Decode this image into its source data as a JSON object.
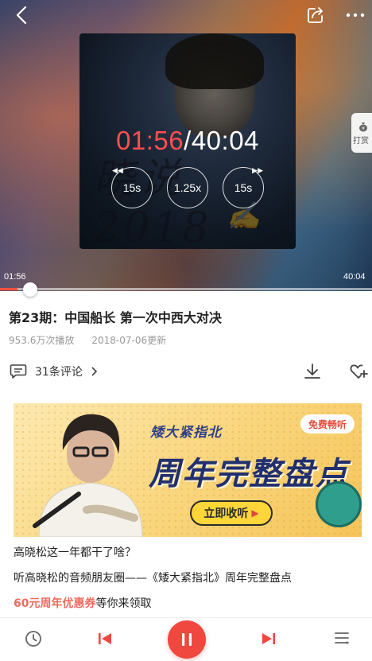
{
  "player": {
    "current_time": "01:56",
    "separator": "/",
    "total_time": "40:04",
    "skip_back_label": "15s",
    "speed_label": "1.25x",
    "skip_forward_label": "15s",
    "progress_start_time": "01:56",
    "progress_end_time": "40:04",
    "progress_fraction": 0.048,
    "tip_label": "打赏",
    "cover_signature_text": "晓说 2018",
    "accent_color": "#f0473e"
  },
  "episode": {
    "title": "第23期：中国船长 第一次中西大对决",
    "plays": "953.6万次播放",
    "updated": "2018-07-06更新",
    "comments_label": "31条评论"
  },
  "banner": {
    "brand": "矮大紧指北",
    "headline": "周年完整盘点",
    "free_badge": "免费畅听",
    "cta_label": "立即收听"
  },
  "ad_text": {
    "line1": "高晓松这一年都干了啥？",
    "line2": "听高晓松的音频朋友圈——《矮大紧指北》周年完整盘点",
    "line3_highlight": "60元周年优惠券",
    "line3_rest": "等你来领取"
  },
  "icons": {
    "back": "back-arrow-icon",
    "share": "share-icon",
    "more": "more-icon",
    "comment": "comment-icon",
    "download": "download-icon",
    "favorite": "heart-add-icon",
    "history": "clock-icon",
    "prev": "previous-icon",
    "play_pause": "pause-icon",
    "next": "next-icon",
    "playlist": "playlist-icon"
  }
}
